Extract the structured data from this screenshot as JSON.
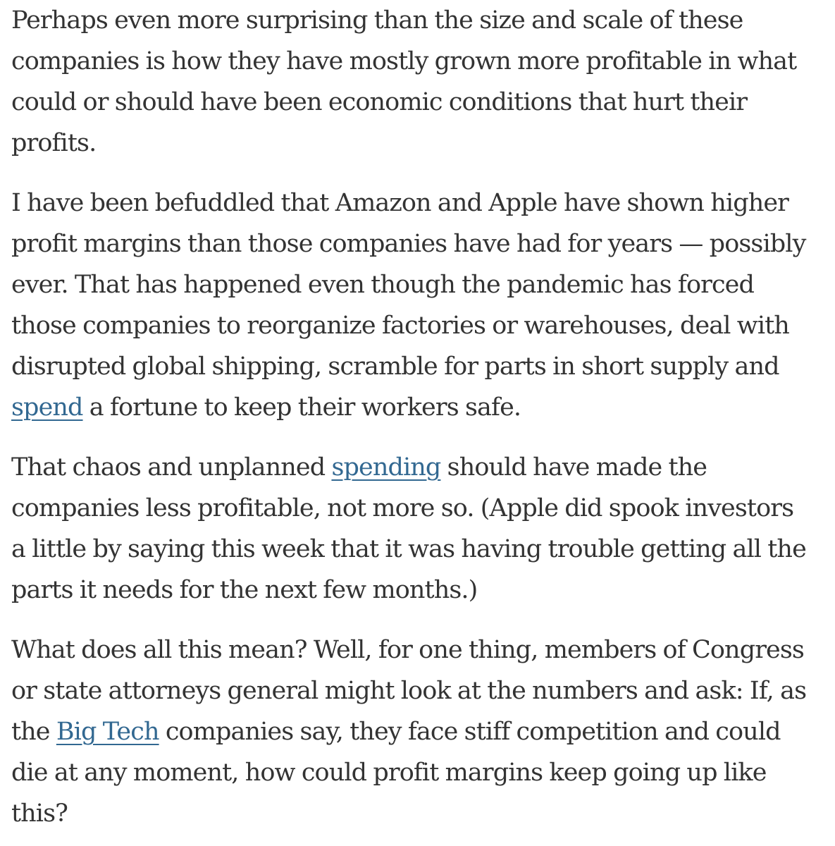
{
  "colors": {
    "text": "#333333",
    "link": "#326891",
    "background": "#ffffff"
  },
  "paragraphs": [
    {
      "lines": [
        "Perhaps even more surprising than the size and scale of these",
        "companies is how they have mostly grown more profitable in what",
        "could or should have been economic conditions that hurt their",
        "profits."
      ]
    },
    {
      "lines": [
        "I have been befuddled that Amazon and Apple have shown higher",
        "profit margins than those companies have had for years — possibly",
        "ever. That has happened even though the pandemic has forced",
        "those companies to reorganize factories or warehouses, deal with",
        "disrupted global shipping, scramble for parts in short supply and"
      ],
      "last_line": {
        "link_text": "spend",
        "after_text": " a fortune to keep their workers safe."
      }
    },
    {
      "first_line": {
        "before_text": "That chaos and unplanned ",
        "link_text": "spending",
        "after_text": " should have made the"
      },
      "lines": [
        "companies less profitable, not more so. (Apple did spook investors",
        "a little by saying this week that it was having trouble getting all the",
        "parts it needs for the next few months.)"
      ]
    },
    {
      "lines": [
        "What does all this mean? Well, for one thing, members of Congress",
        "or state attorneys general might look at the numbers and ask: If, as"
      ],
      "link_line": {
        "before_text": "the ",
        "link_text": "Big Tech",
        "after_text": " companies say, they face stiff competition and could"
      },
      "tail_lines": [
        "die at any moment, how could profit margins keep going up like",
        "this?"
      ]
    }
  ]
}
